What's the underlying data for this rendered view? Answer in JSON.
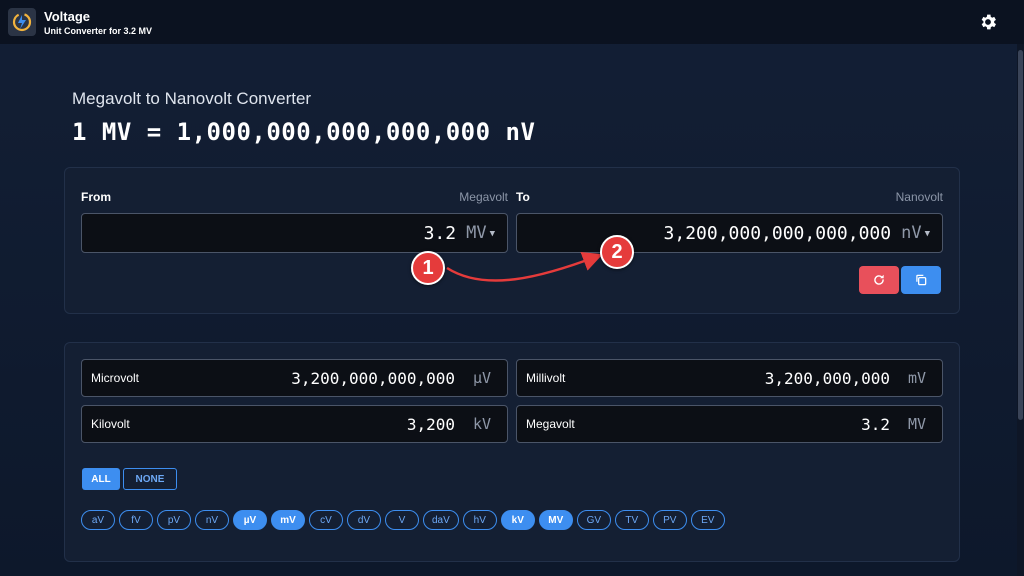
{
  "app": {
    "title": "Voltage",
    "subtitle": "Unit Converter for 3.2 MV",
    "icon": "voltage-converter-logo-icon",
    "settings_icon": "gear-icon"
  },
  "converter": {
    "heading": "Megavolt to Nanovolt Converter",
    "equation": "1 MV = 1,000,000,000,000,000 nV",
    "from_label": "From",
    "from_unit_name": "Megavolt",
    "from_value": "3.2",
    "from_unit": "MV",
    "to_label": "To",
    "to_unit_name": "Nanovolt",
    "to_value": "3,200,000,000,000,000",
    "to_unit": "nV",
    "reset_icon": "refresh-icon",
    "copy_icon": "copy-icon"
  },
  "annotations": {
    "first": "1",
    "second": "2"
  },
  "results": [
    {
      "name": "Microvolt",
      "value": "3,200,000,000,000",
      "unit": "µV"
    },
    {
      "name": "Millivolt",
      "value": "3,200,000,000",
      "unit": "mV"
    },
    {
      "name": "Kilovolt",
      "value": "3,200",
      "unit": "kV"
    },
    {
      "name": "Megavolt",
      "value": "3.2",
      "unit": "MV"
    }
  ],
  "filters": {
    "all_label": "ALL",
    "none_label": "NONE",
    "units": [
      {
        "label": "aV",
        "selected": false
      },
      {
        "label": "fV",
        "selected": false
      },
      {
        "label": "pV",
        "selected": false
      },
      {
        "label": "nV",
        "selected": false
      },
      {
        "label": "µV",
        "selected": true
      },
      {
        "label": "mV",
        "selected": true
      },
      {
        "label": "cV",
        "selected": false
      },
      {
        "label": "dV",
        "selected": false
      },
      {
        "label": "V",
        "selected": false
      },
      {
        "label": "daV",
        "selected": false
      },
      {
        "label": "hV",
        "selected": false
      },
      {
        "label": "kV",
        "selected": true
      },
      {
        "label": "MV",
        "selected": true
      },
      {
        "label": "GV",
        "selected": false
      },
      {
        "label": "TV",
        "selected": false
      },
      {
        "label": "PV",
        "selected": false
      },
      {
        "label": "EV",
        "selected": false
      }
    ]
  },
  "colors": {
    "accent": "#3d8ef0",
    "danger": "#e8505b",
    "annotation": "#e53b3b"
  }
}
